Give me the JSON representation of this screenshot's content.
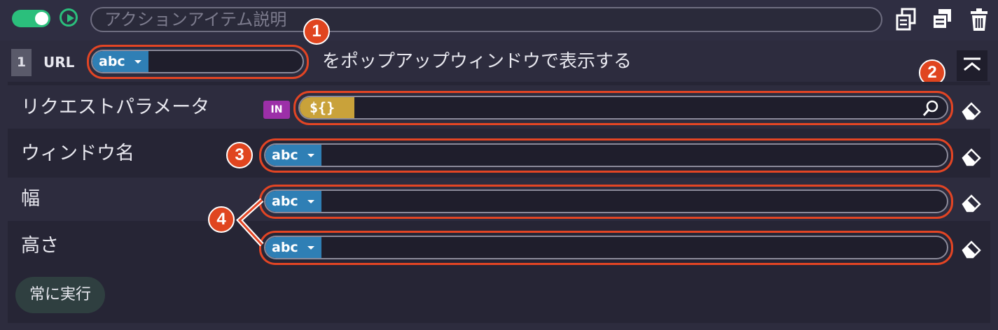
{
  "header": {
    "enabled": true,
    "description_placeholder": "アクションアイテム説明",
    "icons": [
      "copy-icon",
      "duplicate-icon",
      "trash-icon"
    ]
  },
  "url_row": {
    "step_number": "1",
    "label": "URL",
    "value_type": "abc",
    "suffix": "をポップアップウィンドウで表示する"
  },
  "params": [
    {
      "label": "リクエストパラメータ",
      "tag": "IN",
      "value_type": "${}"
    },
    {
      "label": "ウィンドウ名",
      "value_type": "abc"
    },
    {
      "label": "幅",
      "value_type": "abc"
    },
    {
      "label": "高さ",
      "value_type": "abc"
    }
  ],
  "footer": {
    "always_run_label": "常に実行"
  },
  "badges": [
    "1",
    "2",
    "3",
    "4"
  ],
  "colors": {
    "accent_green": "#2bbf7c",
    "abc_blue": "#2f7fb5",
    "template_gold": "#c9a23a",
    "in_purple": "#9c2fa8",
    "annotation_red": "#e34524"
  }
}
